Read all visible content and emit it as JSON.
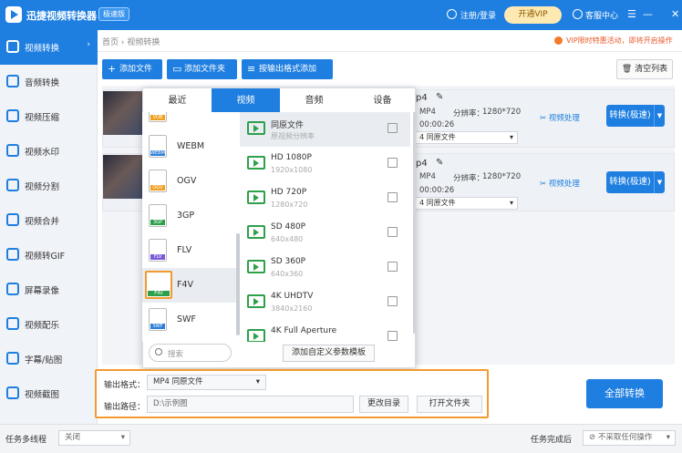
{
  "app": {
    "title": "迅捷视频转换器",
    "badge": "极速版"
  },
  "header": {
    "login": "注册/登录",
    "vip_button": "开通VIP",
    "service": "客服中心",
    "controls": [
      "☰",
      "—",
      "☐",
      "✕"
    ]
  },
  "sidebar": {
    "items": [
      {
        "label": "视频转换",
        "icon": "video-convert-icon"
      },
      {
        "label": "音频转换",
        "icon": "audio-icon"
      },
      {
        "label": "视频压缩",
        "icon": "compress-icon"
      },
      {
        "label": "视频水印",
        "icon": "watermark-icon"
      },
      {
        "label": "视频分割",
        "icon": "split-icon"
      },
      {
        "label": "视频合并",
        "icon": "merge-icon"
      },
      {
        "label": "视频转GIF",
        "icon": "gif-icon"
      },
      {
        "label": "屏幕录像",
        "icon": "record-icon"
      },
      {
        "label": "视频配乐",
        "icon": "music-icon"
      },
      {
        "label": "字幕/贴图",
        "icon": "subtitle-icon"
      },
      {
        "label": "视频截图",
        "icon": "screenshot-icon"
      }
    ],
    "arrow": "›"
  },
  "breadcrumb": "首页 › 视频转换",
  "promo": "VIP限时特惠活动，即将开启操作",
  "toolbar": {
    "add_file": "添加文件",
    "add_folder": "添加文件夹",
    "add_by_format": "按输出格式添加",
    "clear_list": "清空列表"
  },
  "files": [
    {
      "name": "p4",
      "format": "MP4",
      "res_label": "分辨率：",
      "resolution": "1280*720",
      "duration": "00:00:26",
      "preset": "4  同原文件",
      "process": "视频处理",
      "convert": "转换(极速)"
    },
    {
      "name": "p4",
      "format": "MP4",
      "res_label": "分辨率：",
      "resolution": "1280*720",
      "duration": "00:00:26",
      "preset": "4  同原文件",
      "process": "视频处理",
      "convert": "转换(极速)"
    }
  ],
  "popup": {
    "tabs": [
      "最近",
      "视频",
      "音频",
      "设备"
    ],
    "active_tab": "视频",
    "formats": [
      {
        "label": "VOB",
        "tag_color": "#f0a020"
      },
      {
        "label": "WEBM",
        "tag_color": "#2e7fd8"
      },
      {
        "label": "OGV",
        "tag_color": "#f0a020"
      },
      {
        "label": "3GP",
        "tag_color": "#2ea04a"
      },
      {
        "label": "FLV",
        "tag_color": "#7a5ad8"
      },
      {
        "label": "F4V",
        "tag_color": "#2ea04a"
      },
      {
        "label": "SWF",
        "tag_color": "#2e7fd8"
      }
    ],
    "selected_format": "F4V",
    "presets": [
      {
        "title": "同原文件",
        "sub": "原视频分辨率"
      },
      {
        "title": "HD 1080P",
        "sub": "1920x1080"
      },
      {
        "title": "HD 720P",
        "sub": "1280x720"
      },
      {
        "title": "SD 480P",
        "sub": "640x480"
      },
      {
        "title": "SD 360P",
        "sub": "640x360"
      },
      {
        "title": "4K UHDTV",
        "sub": "3840x2160"
      },
      {
        "title": "4K Full Aperture",
        "sub": ""
      }
    ],
    "search_placeholder": "搜索",
    "custom_button": "添加自定义参数模板"
  },
  "output": {
    "format_label": "输出格式：",
    "format_value": "MP4  同原文件",
    "path_label": "输出路径：",
    "path_value": "D:\\示例图",
    "change_dir": "更改目录",
    "open_folder": "打开文件夹",
    "convert_all": "全部转换"
  },
  "statusbar": {
    "multithread_label": "任务多线程",
    "multithread_value": "关闭",
    "complete_label": "任务完成后",
    "complete_value": "不采取任何操作"
  },
  "colors": {
    "primary": "#1f7fe0",
    "highlight": "#f39a2e"
  }
}
